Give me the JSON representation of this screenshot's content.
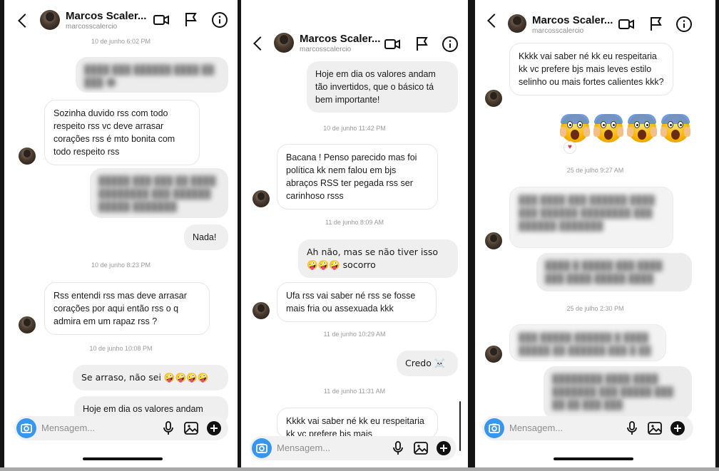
{
  "contact": {
    "name": "Marcos Scaler...",
    "username": "marcosscalercio"
  },
  "composer": {
    "placeholder": "Mensagem..."
  },
  "icons": {
    "back": "chevron-left-icon",
    "video": "video-camera-icon",
    "flag": "flag-icon",
    "info": "info-icon",
    "camera": "camera-icon",
    "mic": "microphone-icon",
    "gallery": "image-icon",
    "add": "plus-circle-icon"
  },
  "colors": {
    "accent": "#3797f0",
    "outgoing_bubble": "#efefef",
    "incoming_bubble": "#ffffff"
  },
  "panel1": {
    "timestamps": [
      "10 de junho 6:02 PM",
      "10 de junho 8:23 PM",
      "10 de junho 10:08 PM"
    ],
    "messages": [
      "Sozinha duvido rss com todo respeito rss vc deve arrasar corações rss é mto bonita com todo respeito rss",
      "Nada!",
      "Rss entendi rss mas deve arrasar corações por aqui então rss o q admira em um rapaz rss ?",
      "Se arraso, não sei 🤪🤪🤪🤪",
      "Hoje em dia os valores andam"
    ]
  },
  "panel2": {
    "timestamps": [
      "10 de junho 11:42 PM",
      "11 de junho 8:09 AM",
      "11 de junho 10:29 AM",
      "11 de junho 11:31 AM"
    ],
    "messages": [
      "Hoje em dia os valores andam tão invertidos, que o básico tá bem importante!",
      "Bacana ! Penso parecido mas foi política kk nem falou em bjs abraços RSS ter pegada rss ser carinhoso rsss",
      "Ah não, mas se não tiver isso 🤪🤪🤪 socorro",
      "Ufa rss vai saber né rss se fosse mais fria ou assexuada kkk",
      "Credo ☠️",
      "Kkkk vai saber né kk eu respeitaria kk vc prefere bjs mais"
    ]
  },
  "panel3": {
    "timestamps": [
      "25 de julho 9:27 AM",
      "25 de julho 2:30 PM"
    ],
    "messages": [
      "Kkkk vai saber né kk eu respeitaria kk vc prefere bjs mais leves estilo selinho ou mais fortes calientes kkk?"
    ],
    "reaction_emoji": "😱😱😱😱",
    "reaction": "❤️"
  }
}
